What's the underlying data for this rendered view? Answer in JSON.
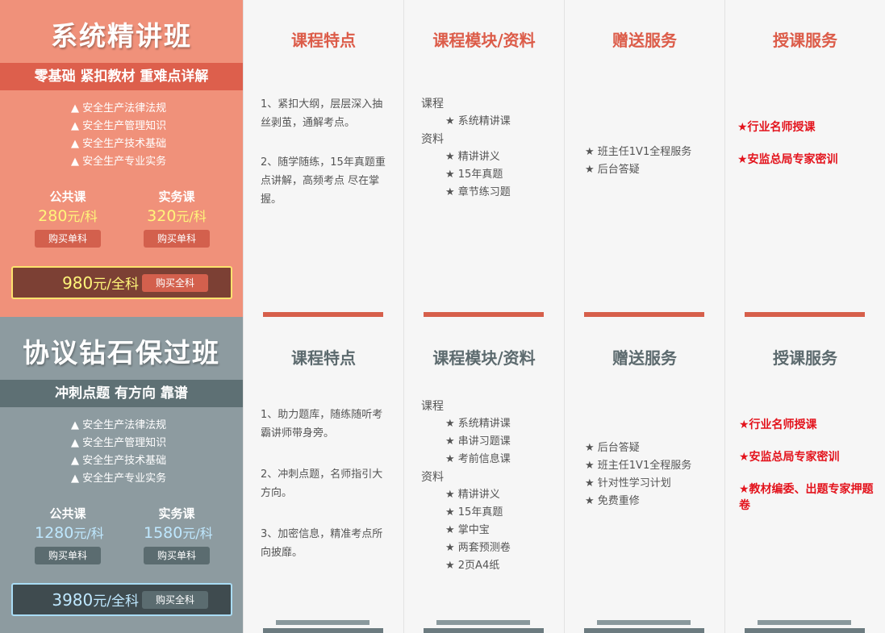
{
  "packages": [
    {
      "title": "系统精讲班",
      "slogan": "零基础 紧扣教材 重难点详解",
      "features": [
        "▲ 安全生产法律法规",
        "▲ 安全生产管理知识",
        "▲ 安全生产技术基础",
        "▲ 安全生产专业实务"
      ],
      "public_label": "公共课",
      "public_price": "280",
      "practice_label": "实务课",
      "practice_price": "320",
      "unit_per": "元/科",
      "buy_single": "购买单科",
      "total_price": "980",
      "unit_total": "元/全科",
      "buy_all": "购买全科",
      "col_titles": [
        "课程特点",
        "课程模块/资料",
        "赠送服务",
        "授课服务"
      ],
      "traits": [
        "1、紧扣大纲，层层深入抽丝剥茧，通解考点。",
        "2、随学随练，15年真题重点讲解，高频考点 尽在掌握。"
      ],
      "module_course_label": "课程",
      "module_courses": [
        "★ 系统精讲课"
      ],
      "module_material_label": "资料",
      "module_materials": [
        "★ 精讲讲义",
        "★ 15年真题",
        "★ 章节练习题"
      ],
      "services": [
        "★ 班主任1V1全程服务",
        "★ 后台答疑"
      ],
      "teaching": [
        "★行业名师授课",
        "★安监总局专家密训"
      ]
    },
    {
      "title": "协议钻石保过班",
      "slogan": "冲刺点题 有方向 靠谱",
      "features": [
        "▲ 安全生产法律法规",
        "▲ 安全生产管理知识",
        "▲ 安全生产技术基础",
        "▲ 安全生产专业实务"
      ],
      "public_label": "公共课",
      "public_price": "1280",
      "practice_label": "实务课",
      "practice_price": "1580",
      "unit_per": "元/科",
      "buy_single": "购买单科",
      "total_price": "3980",
      "unit_total": "元/全科",
      "buy_all": "购买全科",
      "col_titles": [
        "课程特点",
        "课程模块/资料",
        "赠送服务",
        "授课服务"
      ],
      "traits": [
        "1、助力题库，随练随听考霸讲师带身旁。",
        "2、冲刺点题，名师指引大方向。",
        "3、加密信息，精准考点所向披靡。"
      ],
      "module_course_label": "课程",
      "module_courses": [
        "★ 系统精讲课",
        "★ 串讲习题课",
        "★ 考前信息课"
      ],
      "module_material_label": "资料",
      "module_materials": [
        "★ 精讲讲义",
        "★ 15年真题",
        "★ 掌中宝",
        "★ 两套预测卷",
        "★ 2页A4纸"
      ],
      "services": [
        "★ 后台答疑",
        "★ 班主任1V1全程服务",
        "★ 针对性学习计划",
        "★ 免费重修"
      ],
      "teaching": [
        "★行业名师授课",
        "★安监总局专家密训",
        "★教材编委、出题专家押题卷"
      ]
    }
  ]
}
